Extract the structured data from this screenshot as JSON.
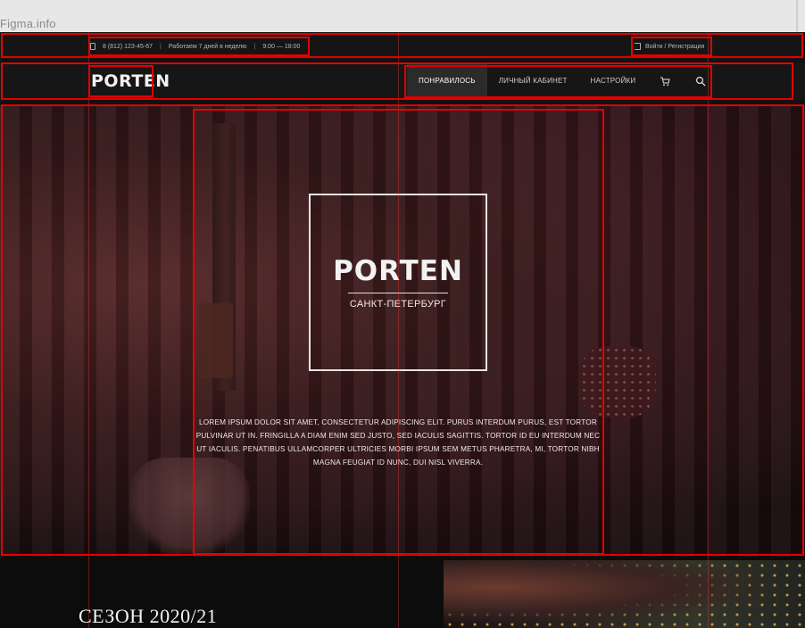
{
  "browser": {
    "title": "Figma.info"
  },
  "topbar": {
    "phone": "8 (812) 123-45-67",
    "hours_label": "Работаем 7 дней в неделю",
    "hours": "9:00 — 18:00",
    "login": "Войти / Регистрация"
  },
  "nav": {
    "logo": "PORTEN",
    "items": [
      "ПОНРАВИЛОСЬ",
      "ЛИЧНЫЙ КАБИНЕТ",
      "НАСТРОЙКИ"
    ],
    "icons": [
      "cart-icon",
      "search-icon"
    ]
  },
  "hero": {
    "brand": "PORTEN",
    "city": "САНКТ-ПЕТЕРБУРГ",
    "text": "LOREM IPSUM DOLOR SIT AMET, CONSECTETUR ADIPISCING ELIT. PURUS INTERDUM PURUS, EST TORTOR PULVINAR UT IN. FRINGILLA A DIAM ENIM SED JUSTO, SED IACULIS SAGITTIS. TORTOR ID EU INTERDUM NEC UT IACULIS. PENATIBUS ULLAMCORPER ULTRICIES MORBI IPSUM SEM METUS PHARETRA, MI, TORTOR NIBH MAGNA FEUGIAT ID NUNC, DUI NISL VIVERRA."
  },
  "season": {
    "title": "СЕЗОН 2020/21"
  },
  "colors": {
    "outline": "#e40000",
    "background": "#111111",
    "text": "#f2f2f2"
  }
}
